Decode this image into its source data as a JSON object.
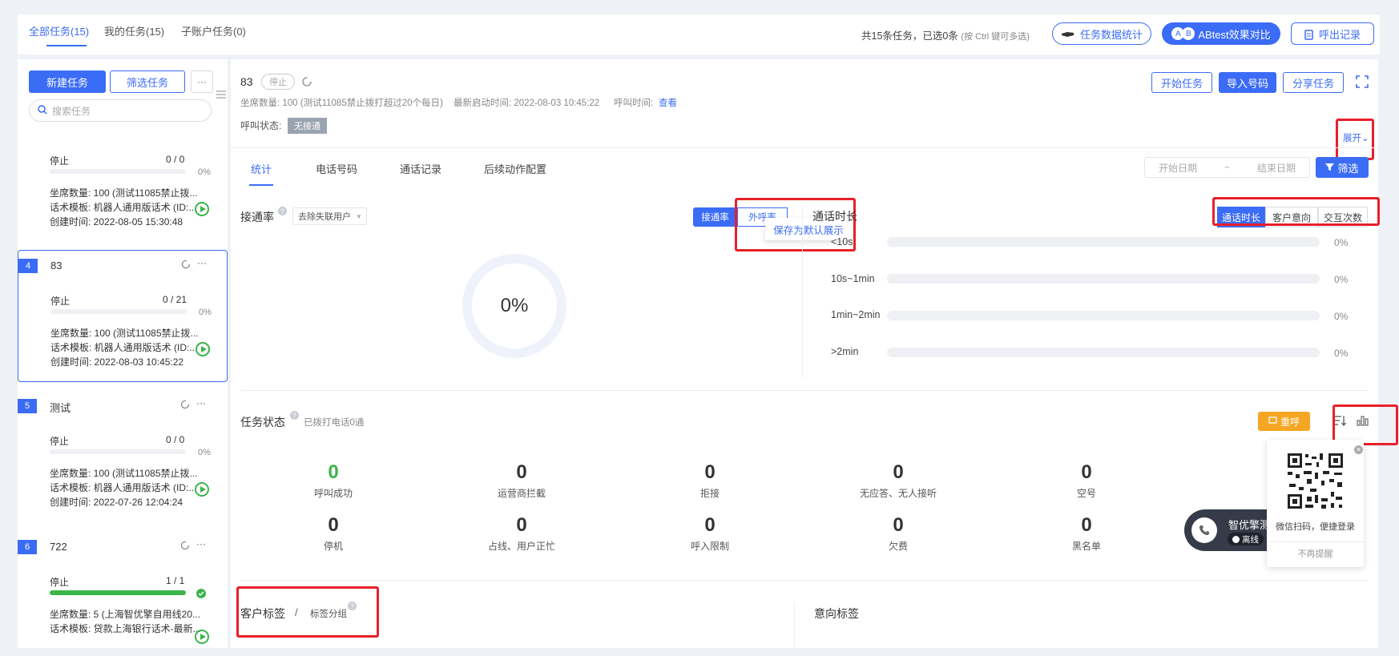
{
  "top_tabs": [
    {
      "label": "全部任务(15)",
      "active": true
    },
    {
      "label": "我的任务(15)",
      "active": false
    },
    {
      "label": "子账户任务(0)",
      "active": false
    }
  ],
  "header": {
    "count_text": "共15条任务，已选0条",
    "hint_text": "(按 Ctrl 键可多选)",
    "stats_button": "任务数据统计",
    "abtest_button": "ABtest效果对比",
    "call_record_button": "呼出记录"
  },
  "sidebar": {
    "new_task": "新建任务",
    "filter_task": "筛选任务",
    "more": "···",
    "search_placeholder": "搜索任务",
    "tasks": [
      {
        "badge": "",
        "name": "",
        "status": "停止",
        "count": "0 / 0",
        "pct": "0%",
        "progress": 0,
        "seats": "坐席数量: 100 (测试11085禁止拨...",
        "template": "话术模板: 机器人通用版话术 (ID:...",
        "created": "创建时间: 2022-08-05 15:30:48",
        "state_icon": "play-icon"
      },
      {
        "badge": "4",
        "name": "83",
        "status": "停止",
        "count": "0 / 21",
        "pct": "0%",
        "progress": 0,
        "seats": "坐席数量: 100 (测试11085禁止拨...",
        "template": "话术模板: 机器人通用版话术 (ID:...",
        "created": "创建时间: 2022-08-03 10:45:22",
        "state_icon": "play-icon"
      },
      {
        "badge": "5",
        "name": "测试",
        "status": "停止",
        "count": "0 / 0",
        "pct": "0%",
        "progress": 0,
        "seats": "坐席数量: 100 (测试11085禁止拨...",
        "template": "话术模板: 机器人通用版话术 (ID:...",
        "created": "创建时间: 2022-07-26 12:04:24",
        "state_icon": "play-icon"
      },
      {
        "badge": "6",
        "name": "722",
        "status": "停止",
        "count": "1 / 1",
        "pct": "",
        "progress": 1,
        "seats": "坐席数量: 5 (上海智优擎自用线20...",
        "template": "话术模板: 贷款上海银行话术-最新...",
        "created": "",
        "state_icon": "check-icon"
      }
    ]
  },
  "detail": {
    "title": "83",
    "status_tag": "停止",
    "seat_info": "坐席数量:   100 (测试11085禁止拨打超过20个每日)",
    "start_time": "最新启动时间: 2022-08-03 10:45:22",
    "call_time_label": "呼叫时间:",
    "call_time_link": "查看",
    "call_status_label": "呼叫状态:",
    "call_status_value": "无接通",
    "start_btn": "开始任务",
    "import_btn": "导入号码",
    "share_btn": "分享任务",
    "expand": "展开"
  },
  "sub_tabs": [
    {
      "label": "统计",
      "active": true
    },
    {
      "label": "电话号码",
      "active": false
    },
    {
      "label": "通话记录",
      "active": false
    },
    {
      "label": "后续动作配置",
      "active": false
    }
  ],
  "date_filter": {
    "start": "开始日期",
    "sep": "~",
    "end": "结束日期",
    "filter_btn": "筛选"
  },
  "connect_rate": {
    "title": "接通率",
    "select": "去除失联用户",
    "toggle_a": "接通率",
    "toggle_b": "外呼率",
    "popup": "保存为默认展示",
    "center_value": "0%"
  },
  "duration": {
    "title": "通话时长",
    "seg_1": "通话时长",
    "seg_2": "客户意向",
    "seg_3": "交互次数",
    "rows": [
      {
        "label": "<10s",
        "pct": "0%"
      },
      {
        "label": "10s~1min",
        "pct": "0%"
      },
      {
        "label": "1min~2min",
        "pct": "0%"
      },
      {
        "label": ">2min",
        "pct": "0%"
      }
    ]
  },
  "task_status": {
    "title": "任务状态",
    "sub": "已拨打电话0通",
    "recall": "重呼",
    "stats": [
      {
        "value": "0",
        "label": "呼叫成功",
        "color": "#3bb44a"
      },
      {
        "value": "0",
        "label": "运营商拦截",
        "color": "#333333"
      },
      {
        "value": "0",
        "label": "拒接",
        "color": "#333333"
      },
      {
        "value": "0",
        "label": "无应答、无人接听",
        "color": "#333333"
      },
      {
        "value": "0",
        "label": "空号",
        "color": "#333333"
      },
      {
        "value": "0",
        "label": "停机",
        "color": "#333333"
      },
      {
        "value": "0",
        "label": "占线、用户正忙",
        "color": "#333333"
      },
      {
        "value": "0",
        "label": "呼入限制",
        "color": "#333333"
      },
      {
        "value": "0",
        "label": "欠费",
        "color": "#333333"
      },
      {
        "value": "0",
        "label": "黑名单",
        "color": "#333333"
      }
    ]
  },
  "tags": {
    "customer": "客户标签",
    "sep": "/",
    "group": "标签分组",
    "intent": "意向标签"
  },
  "floating": {
    "name": "智优擎测",
    "state": "离线",
    "qr_text": "微信扫码，便捷登录",
    "dismiss": "不再提醒"
  }
}
